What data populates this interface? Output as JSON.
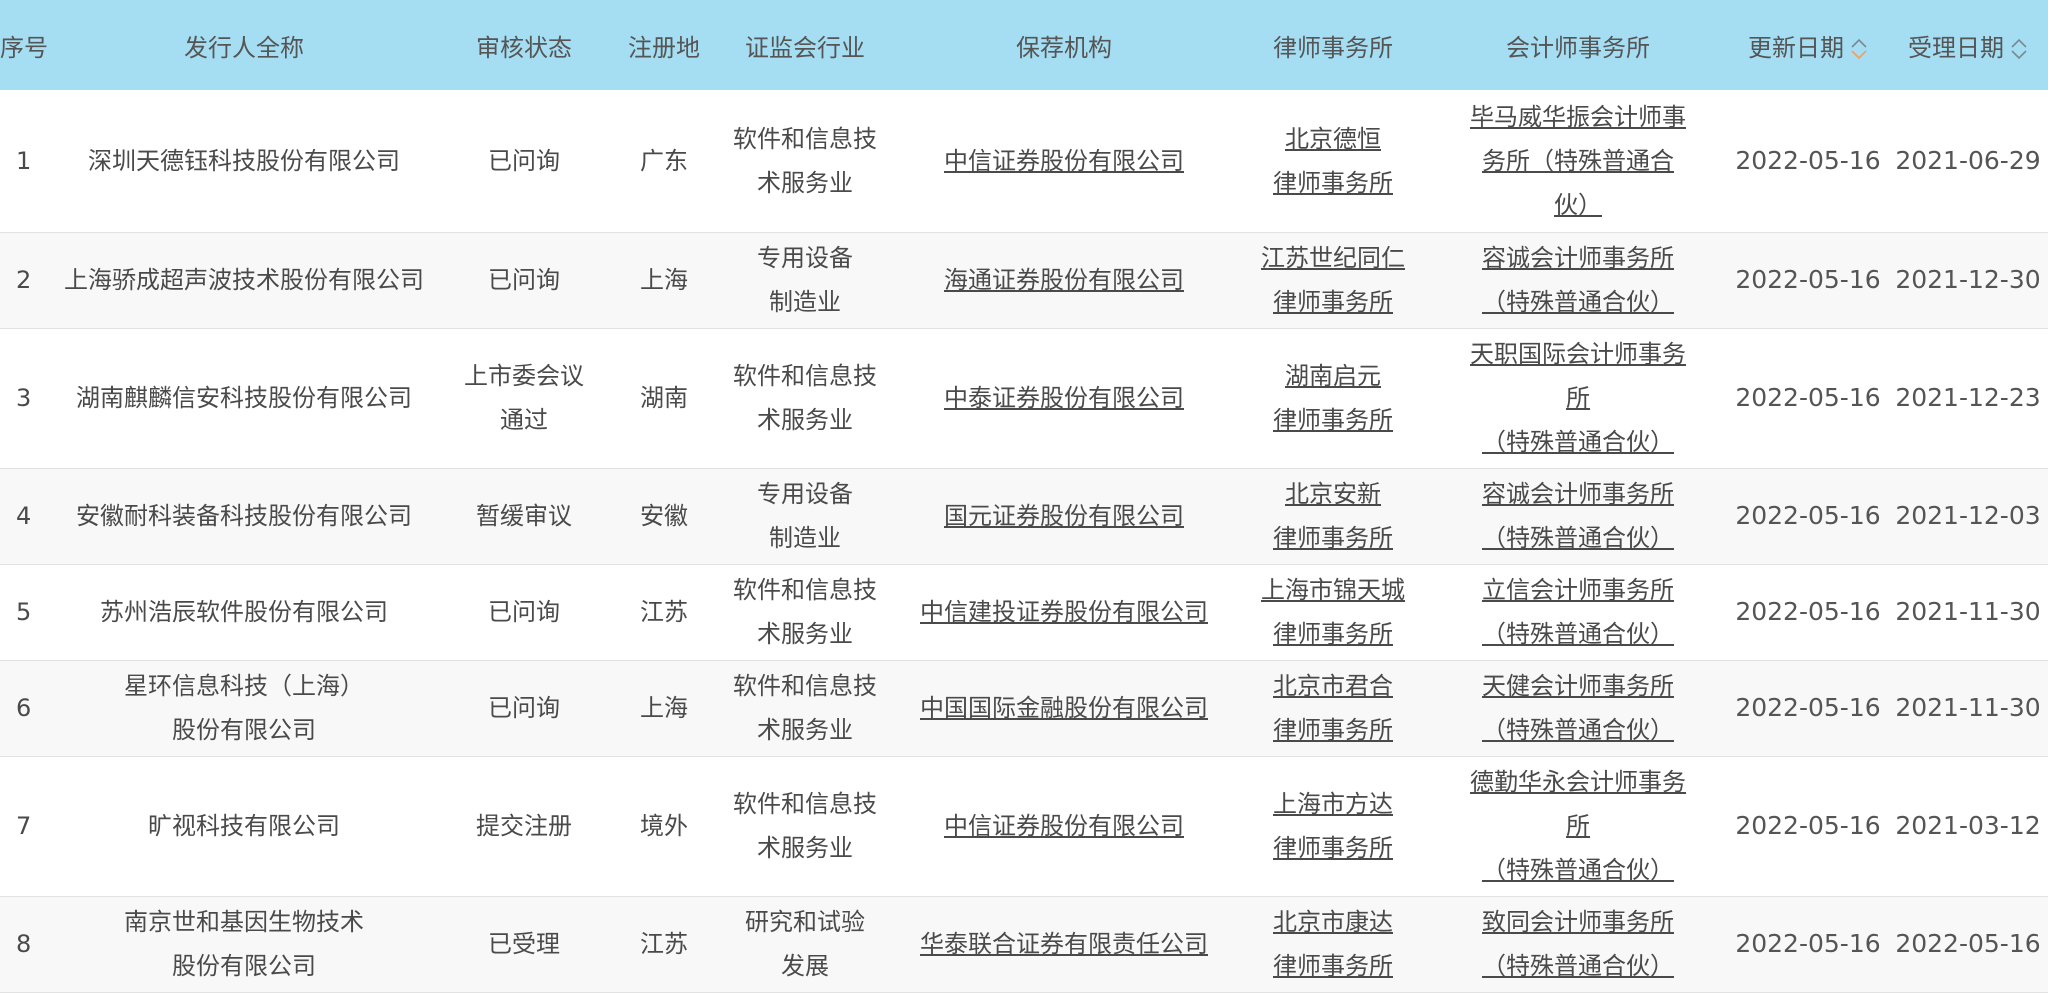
{
  "table": {
    "headers": {
      "seq": "序号",
      "issuer": "发行人全称",
      "status": "审核状态",
      "region": "注册地",
      "industry": "证监会行业",
      "sponsor": "保荐机构",
      "law_firm": "律师事务所",
      "accounting_firm": "会计师事务所",
      "update_date": "更新日期",
      "accept_date": "受理日期"
    },
    "sort": {
      "update_date": "descending",
      "accept_date": "none"
    },
    "colors": {
      "header_bg": "#a5def2",
      "active_sort": "#f0a060",
      "inactive_sort": "#7a8a90"
    },
    "rows": [
      {
        "seq": "1",
        "issuer": [
          "深圳天德钰科技股份有限公司"
        ],
        "status": [
          "已问询"
        ],
        "region": "广东",
        "industry": [
          "软件和信息技",
          "术服务业"
        ],
        "sponsor": "中信证券股份有限公司",
        "law_firm": [
          "北京德恒",
          "律师事务所"
        ],
        "accounting_firm": [
          "毕马威华振会计师事",
          "务所（特殊普通合",
          "伙）"
        ],
        "update_date": "2022-05-16",
        "accept_date": "2021-06-29"
      },
      {
        "seq": "2",
        "issuer": [
          "上海骄成超声波技术股份有限公司"
        ],
        "status": [
          "已问询"
        ],
        "region": "上海",
        "industry": [
          "专用设备",
          "制造业"
        ],
        "sponsor": "海通证券股份有限公司",
        "law_firm": [
          "江苏世纪同仁",
          "律师事务所"
        ],
        "accounting_firm": [
          "容诚会计师事务所",
          "（特殊普通合伙）"
        ],
        "update_date": "2022-05-16",
        "accept_date": "2021-12-30"
      },
      {
        "seq": "3",
        "issuer": [
          "湖南麒麟信安科技股份有限公司"
        ],
        "status": [
          "上市委会议",
          "通过"
        ],
        "region": "湖南",
        "industry": [
          "软件和信息技",
          "术服务业"
        ],
        "sponsor": "中泰证券股份有限公司",
        "law_firm": [
          "湖南启元",
          "律师事务所"
        ],
        "accounting_firm": [
          "天职国际会计师事务",
          "所",
          "（特殊普通合伙）"
        ],
        "update_date": "2022-05-16",
        "accept_date": "2021-12-23"
      },
      {
        "seq": "4",
        "issuer": [
          "安徽耐科装备科技股份有限公司"
        ],
        "status": [
          "暂缓审议"
        ],
        "region": "安徽",
        "industry": [
          "专用设备",
          "制造业"
        ],
        "sponsor": "国元证券股份有限公司",
        "law_firm": [
          "北京安新",
          "律师事务所"
        ],
        "accounting_firm": [
          "容诚会计师事务所",
          "（特殊普通合伙）"
        ],
        "update_date": "2022-05-16",
        "accept_date": "2021-12-03"
      },
      {
        "seq": "5",
        "issuer": [
          "苏州浩辰软件股份有限公司"
        ],
        "status": [
          "已问询"
        ],
        "region": "江苏",
        "industry": [
          "软件和信息技",
          "术服务业"
        ],
        "sponsor": "中信建投证券股份有限公司",
        "law_firm": [
          "上海市锦天城",
          "律师事务所"
        ],
        "accounting_firm": [
          "立信会计师事务所",
          "（特殊普通合伙）"
        ],
        "update_date": "2022-05-16",
        "accept_date": "2021-11-30"
      },
      {
        "seq": "6",
        "issuer": [
          "星环信息科技（上海）",
          "股份有限公司"
        ],
        "status": [
          "已问询"
        ],
        "region": "上海",
        "industry": [
          "软件和信息技",
          "术服务业"
        ],
        "sponsor": "中国国际金融股份有限公司",
        "law_firm": [
          "北京市君合",
          "律师事务所"
        ],
        "accounting_firm": [
          "天健会计师事务所",
          "（特殊普通合伙）"
        ],
        "update_date": "2022-05-16",
        "accept_date": "2021-11-30"
      },
      {
        "seq": "7",
        "issuer": [
          "旷视科技有限公司"
        ],
        "status": [
          "提交注册"
        ],
        "region": "境外",
        "industry": [
          "软件和信息技",
          "术服务业"
        ],
        "sponsor": "中信证券股份有限公司",
        "law_firm": [
          "上海市方达",
          "律师事务所"
        ],
        "accounting_firm": [
          "德勤华永会计师事务",
          "所",
          "（特殊普通合伙）"
        ],
        "update_date": "2022-05-16",
        "accept_date": "2021-03-12"
      },
      {
        "seq": "8",
        "issuer": [
          "南京世和基因生物技术",
          "股份有限公司"
        ],
        "status": [
          "已受理"
        ],
        "region": "江苏",
        "industry": [
          "研究和试验",
          "发展"
        ],
        "sponsor": "华泰联合证券有限责任公司",
        "law_firm": [
          "北京市康达",
          "律师事务所"
        ],
        "accounting_firm": [
          "致同会计师事务所",
          "（特殊普通合伙）"
        ],
        "update_date": "2022-05-16",
        "accept_date": "2022-05-16"
      }
    ]
  }
}
